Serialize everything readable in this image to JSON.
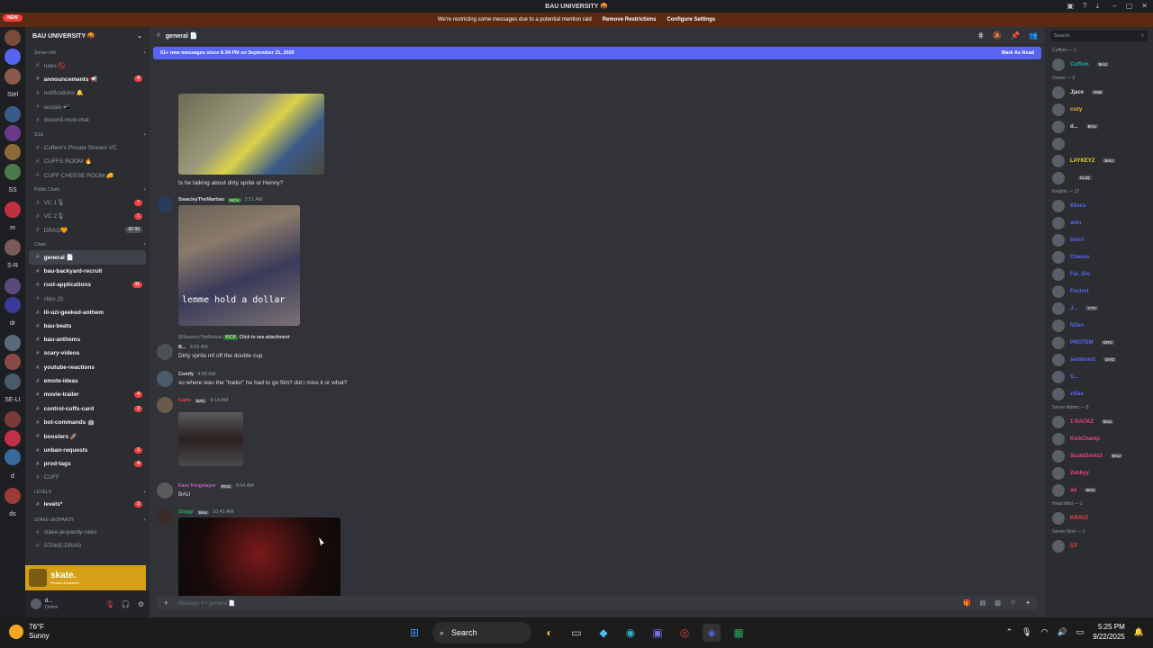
{
  "window": {
    "title": "BAU UNIVERSITY 🤬"
  },
  "notice": {
    "text": "We're restricting some messages due to a potential mention raid",
    "remove": "Remove Restrictions",
    "configure": "Configure Settings"
  },
  "servers": [
    {
      "label": "",
      "color": "#7a4a3a"
    },
    {
      "label": "",
      "color": "#5865f2"
    },
    {
      "label": "",
      "color": "#8a5a4a"
    },
    {
      "label": "Stel",
      "color": ""
    },
    {
      "label": "",
      "color": "#3a5a8a"
    },
    {
      "label": "",
      "color": "#6a3a8a"
    },
    {
      "label": "",
      "color": "#8a6a3a"
    },
    {
      "label": "",
      "color": "#4a7a4a"
    },
    {
      "label": "SS",
      "color": ""
    },
    {
      "label": "",
      "color": "#c03040"
    },
    {
      "label": "m",
      "color": ""
    },
    {
      "label": "",
      "color": "#7a5a5a"
    },
    {
      "label": "S-R",
      "color": ""
    },
    {
      "label": "",
      "color": "#5a4a7a"
    },
    {
      "label": "",
      "color": "#3a3a9a"
    },
    {
      "label": "dr",
      "color": ""
    },
    {
      "label": "",
      "color": "#5a6a7a"
    },
    {
      "label": "",
      "color": "#8a4a4a"
    },
    {
      "label": "",
      "color": "#4a5a6a"
    },
    {
      "label": "SE-LI",
      "color": ""
    },
    {
      "label": "",
      "color": "#7a3a3a"
    },
    {
      "label": "",
      "color": "#c0304a"
    },
    {
      "label": "",
      "color": "#3a6a9a"
    },
    {
      "label": "d",
      "color": ""
    },
    {
      "label": "",
      "color": "#9a3a3a"
    },
    {
      "label": "ds",
      "color": ""
    }
  ],
  "new_badge": "NEW",
  "guild": {
    "name": "BAU UNIVERSITY 🤬"
  },
  "channel_list": [
    {
      "kind": "cat",
      "label": "Server Info"
    },
    {
      "kind": "ch",
      "label": "rules 🚫",
      "unread": false
    },
    {
      "kind": "ch",
      "label": "announcements 📢",
      "unread": true,
      "count": "8"
    },
    {
      "kind": "ch",
      "label": "notifications 🔔",
      "unread": false
    },
    {
      "kind": "ch",
      "label": "socials 📲",
      "unread": false
    },
    {
      "kind": "ch",
      "label": "discord-mod-chat",
      "unread": false
    },
    {
      "kind": "cat",
      "label": "SSS"
    },
    {
      "kind": "ch",
      "label": "Cuffem's Private Stream VC",
      "unread": false
    },
    {
      "kind": "ch",
      "label": "CUFFS ROOM 🔥",
      "unread": false
    },
    {
      "kind": "ch",
      "label": "CUFF CHEESE ROOM 🧀",
      "unread": false
    },
    {
      "kind": "cat",
      "label": "Public Chats"
    },
    {
      "kind": "ch",
      "label": "VC 1🎙",
      "unread": false,
      "count": "7"
    },
    {
      "kind": "ch",
      "label": "VC 2🎙",
      "unread": false,
      "count": "1"
    },
    {
      "kind": "ch",
      "label": "DRAG🧡",
      "unread": false,
      "count": "00 99",
      "gray": true
    },
    {
      "kind": "cat",
      "label": "Chats"
    },
    {
      "kind": "ch",
      "label": "general 📄",
      "unread": true,
      "active": true
    },
    {
      "kind": "ch",
      "label": "bau-backyard-recruit",
      "unread": true
    },
    {
      "kind": "ch",
      "label": "rust-applications",
      "unread": true,
      "count": "11"
    },
    {
      "kind": "ch",
      "label": "clips 🎥",
      "unread": false
    },
    {
      "kind": "ch",
      "label": "lil-uzi-geeked-anthem",
      "unread": true
    },
    {
      "kind": "ch",
      "label": "bau-beats",
      "unread": true
    },
    {
      "kind": "ch",
      "label": "bau-anthems",
      "unread": true
    },
    {
      "kind": "ch",
      "label": "scary-videos",
      "unread": true
    },
    {
      "kind": "ch",
      "label": "youtube-reactions",
      "unread": true
    },
    {
      "kind": "ch",
      "label": "emote-ideas",
      "unread": true
    },
    {
      "kind": "ch",
      "label": "movie-trailer",
      "unread": true,
      "count": "4"
    },
    {
      "kind": "ch",
      "label": "control-cuffs-card",
      "unread": true,
      "count": "2"
    },
    {
      "kind": "ch",
      "label": "bot-commands 🤖",
      "unread": true
    },
    {
      "kind": "ch",
      "label": "boosters 🚀",
      "unread": true
    },
    {
      "kind": "ch",
      "label": "unban-requests",
      "unread": true,
      "count": "1"
    },
    {
      "kind": "ch",
      "label": "prod-tags",
      "unread": true,
      "count": "4"
    },
    {
      "kind": "ch",
      "label": "CUFF",
      "unread": false
    },
    {
      "kind": "cat",
      "label": "LEVELS"
    },
    {
      "kind": "ch",
      "label": "levels*",
      "unread": true,
      "count": "3"
    },
    {
      "kind": "cat",
      "label": "STAKE-JEOPARDY"
    },
    {
      "kind": "ch",
      "label": "stake-jeopardy-rules",
      "unread": false
    },
    {
      "kind": "ch",
      "label": "STAKE-DRAG",
      "unread": false
    }
  ],
  "promo": {
    "title": "skate.",
    "sub": "Reward Available!"
  },
  "user": {
    "name": "d...",
    "status": "Online"
  },
  "channel_header": {
    "name": "general 📄"
  },
  "new_bar": {
    "text": "51+ new messages since 8:34 PM on September 21, 2025",
    "action": "Mark As Read"
  },
  "messages": [
    {
      "author": "Is he talking about dirty sprite or Henny?",
      "is_text_only": true
    },
    {
      "author": "SwacieyTheMartian",
      "tag": "KICK",
      "time": "2:11 AM"
    },
    {
      "caption": "lemme hold a dollar"
    },
    {
      "reply_to": "@SwacieyTheMartian",
      "reply_tag": "KICK",
      "attach": "Click to see attachment",
      "author": "B...",
      "time": "3:29 AM",
      "text": "Dirty sprite mf off the double cup"
    },
    {
      "author": "Comfy",
      "time": "4:58 AM",
      "text": "so where was the \"trailer\" he had to go film? did i miss it or what?"
    },
    {
      "author": "Carlo",
      "tag": "BAU",
      "time": "9:14 AM"
    },
    {
      "author": "Faze Kingslayer",
      "tag": "RGS",
      "time": "9:54 AM",
      "text": "BAU"
    },
    {
      "author": "Staggi",
      "tag": "BAU",
      "time": "10:41 AM"
    }
  ],
  "composer": {
    "placeholder": "Message # • general 📄"
  },
  "member_search": {
    "placeholder": "Search"
  },
  "member_groups": [
    {
      "label": "Cuffem — 1",
      "members": [
        {
          "name": "Cuffem",
          "tag": "BAU",
          "color": "#23a5b0"
        }
      ]
    },
    {
      "label": "Owner — 6",
      "members": [
        {
          "name": "Jjace",
          "tag": "SSB",
          "color": "#dbdee1"
        },
        {
          "name": "cozy",
          "tag": "",
          "color": "#f0b232"
        },
        {
          "name": "d...",
          "tag": "BAU",
          "color": "#dbdee1"
        },
        {
          "name": "",
          "tag": "",
          "color": "#dbdee1"
        },
        {
          "name": "LAYKEYZ",
          "tag": "BAU",
          "color": "#f0d232"
        },
        {
          "name": "",
          "tag": "CLIQ",
          "color": "#dbdee1"
        }
      ]
    },
    {
      "label": "Knights — 12",
      "members": [
        {
          "name": "6Secs",
          "tag": "",
          "color": "#5865f2"
        },
        {
          "name": "adin",
          "tag": "",
          "color": "#5865f2"
        },
        {
          "name": "blurri",
          "tag": "",
          "color": "#5865f2"
        },
        {
          "name": "Cheese",
          "tag": "",
          "color": "#5865f2"
        },
        {
          "name": "Fat_Dio",
          "tag": "",
          "color": "#5865f2"
        },
        {
          "name": "Fostrot",
          "tag": "",
          "color": "#5865f2"
        },
        {
          "name": "J...",
          "tag": "YTG",
          "color": "#5865f2"
        },
        {
          "name": "N3on",
          "tag": "",
          "color": "#5865f2"
        },
        {
          "name": "PROTEM",
          "tag": "ORG",
          "color": "#5865f2"
        },
        {
          "name": "samboest",
          "tag": "OVO",
          "color": "#5865f2"
        },
        {
          "name": "S...",
          "tag": "",
          "color": "#5865f2"
        },
        {
          "name": "zillas",
          "tag": "",
          "color": "#5865f2"
        }
      ]
    },
    {
      "label": "Server Admin — 5",
      "members": [
        {
          "name": "1 RACKZ",
          "tag": "BAU",
          "color": "#f23f88"
        },
        {
          "name": "KickChamp",
          "tag": "",
          "color": "#f23f88"
        },
        {
          "name": "ScamDoolz2",
          "tag": "BAU",
          "color": "#f23f88"
        },
        {
          "name": "Zebbyy",
          "tag": "",
          "color": "#f23f88"
        },
        {
          "name": "ad",
          "tag": "BAU",
          "color": "#f23f88"
        }
      ]
    },
    {
      "label": "Head Mod — 1",
      "members": [
        {
          "name": "KRAVZ",
          "tag": "",
          "color": "#f23f43"
        }
      ]
    },
    {
      "label": "Server Mod — 2",
      "members": [
        {
          "name": "GT",
          "tag": "",
          "color": "#f23f43"
        }
      ]
    }
  ],
  "taskbar": {
    "temp": "76°F",
    "condition": "Sunny",
    "search": "Search",
    "time": "5:25 PM",
    "date": "9/22/2025"
  }
}
